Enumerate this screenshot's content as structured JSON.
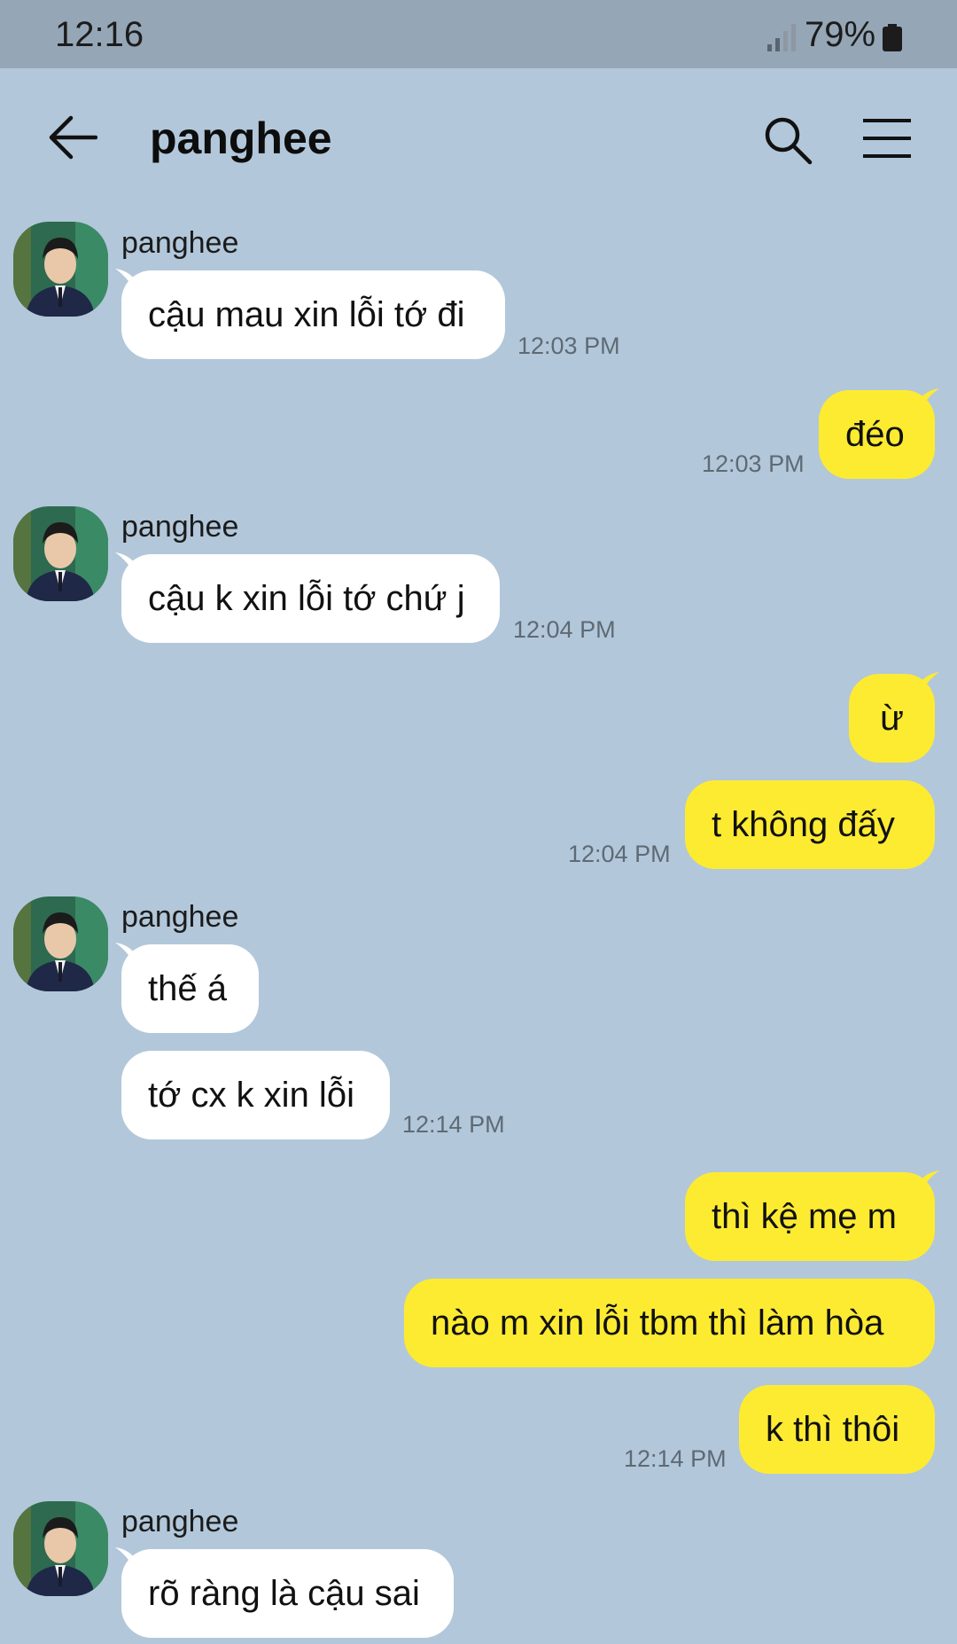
{
  "status": {
    "time": "12:16",
    "battery": "79%"
  },
  "header": {
    "title": "panghee"
  },
  "colors": {
    "background": "#b2c7da",
    "outgoing": "#fdeb32",
    "incoming": "#ffffff"
  },
  "messages": [
    {
      "sender": "panghee",
      "text": "cậu mau xin lỗi tớ đi",
      "time": "12:03 PM"
    },
    {
      "text": "đéo",
      "time": "12:03 PM"
    },
    {
      "sender": "panghee",
      "text": "cậu k xin lỗi tớ chứ j",
      "time": "12:04 PM"
    },
    {
      "text": "ừ"
    },
    {
      "text": "t không đấy",
      "time": "12:04 PM"
    },
    {
      "sender": "panghee",
      "text": "thế á"
    },
    {
      "text": "tớ cx k xin lỗi",
      "time": "12:14 PM"
    },
    {
      "text": "thì kệ mẹ m"
    },
    {
      "text": "nào m xin lỗi tbm thì làm hòa"
    },
    {
      "text": "k thì thôi",
      "time": "12:14 PM"
    },
    {
      "sender": "panghee",
      "text": "rõ ràng là cậu sai"
    }
  ]
}
